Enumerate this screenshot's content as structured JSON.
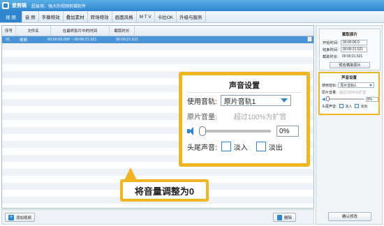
{
  "app": {
    "name": "爱剪辑",
    "slogan": "超易用、强大的视频剪辑软件"
  },
  "menu": [
    {
      "label": "视 频",
      "active": true
    },
    {
      "label": "音 频",
      "active": false
    },
    {
      "label": "字幕特效",
      "active": false
    },
    {
      "label": "叠加素材",
      "active": false
    },
    {
      "label": "转场特效",
      "active": false
    },
    {
      "label": "画面风格",
      "active": false
    },
    {
      "label": "M T V",
      "active": false
    },
    {
      "label": "卡拉OK",
      "active": false
    },
    {
      "label": "升级与服务",
      "active": false
    }
  ],
  "table": {
    "columns": [
      "序号",
      "文件名",
      "在最终影片中的时间",
      "截取时长"
    ],
    "rows": [
      {
        "index": "01",
        "name": "视频",
        "time": "00:00:00.000 ~ 00:00:21.521",
        "duration": "00:00:21.521"
      }
    ]
  },
  "bottom": {
    "add_label": "添加视频",
    "delete_label": "删除"
  },
  "clip_panel": {
    "title": "截取原片",
    "start_label": "开始时间:",
    "start_value": "00:00:00.0",
    "end_label": "结束时间:",
    "end_value": "00:00:21.521",
    "duration_label": "截取时长:",
    "duration_value": "00:00:21.521",
    "preview_label": "预览/截取原片"
  },
  "sound_small": {
    "title": "声音设置",
    "track_label": "使用音轨:",
    "track_value": "原片音轨1",
    "volume_label": "原片音量:",
    "volume_hint": "超过100%为扩音",
    "volume_value": "0%",
    "fade_label": "头尾声音:",
    "fade_in": "淡入",
    "fade_out": "淡出"
  },
  "confirm_label": "确认修改",
  "zoom": {
    "title": "声音设置",
    "track_label": "使用音轨:",
    "track_value": "原片音轨1",
    "volume_label": "原片音量:",
    "volume_hint": "超过100%为扩音",
    "volume_value": "0%",
    "fade_label": "头尾声音:",
    "fade_in": "淡入",
    "fade_out": "淡出"
  },
  "callout_text": "将音量调整为0",
  "colors": {
    "accent": "#2f86cf",
    "highlight": "#f2b522",
    "selected_row": "#4a93d6"
  }
}
